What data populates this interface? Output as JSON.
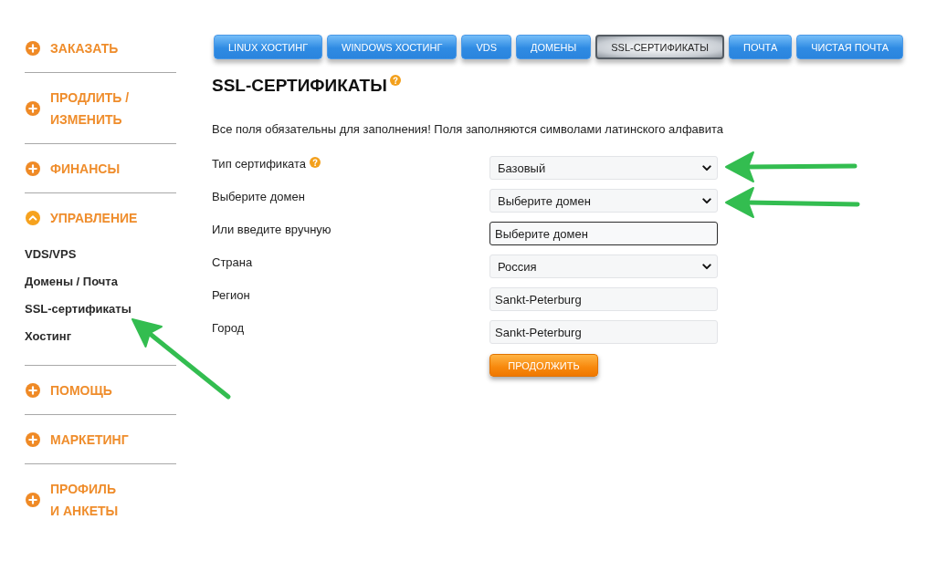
{
  "sidebar": {
    "sections": [
      {
        "label": "ЗАКАЗАТЬ",
        "expanded": false
      },
      {
        "label": "ПРОДЛИТЬ /\nИЗМЕНИТЬ",
        "expanded": false
      },
      {
        "label": "ФИНАНСЫ",
        "expanded": false
      },
      {
        "label": "УПРАВЛЕНИЕ",
        "expanded": true,
        "children": [
          {
            "label": "VDS/VPS"
          },
          {
            "label": "Домены / Почта"
          },
          {
            "label": "SSL-сертификаты"
          },
          {
            "label": "Хостинг"
          }
        ]
      },
      {
        "label": "ПОМОЩЬ",
        "expanded": false
      },
      {
        "label": "МАРКЕТИНГ",
        "expanded": false
      },
      {
        "label": "ПРОФИЛЬ\nИ АНКЕТЫ",
        "expanded": false
      }
    ]
  },
  "tabs": [
    {
      "label": "LINUX ХОСТИНГ",
      "selected": false
    },
    {
      "label": "WINDOWS ХОСТИНГ",
      "selected": false
    },
    {
      "label": "VDS",
      "selected": false
    },
    {
      "label": "ДОМЕНЫ",
      "selected": false
    },
    {
      "label": "SSL-СЕРТИФИКАТЫ",
      "selected": true
    },
    {
      "label": "ПОЧТА",
      "selected": false
    },
    {
      "label": "ЧИСТАЯ ПОЧТА",
      "selected": false
    }
  ],
  "heading": {
    "title": "SSL-СЕРТИФИКАТЫ",
    "help": true
  },
  "note": "Все поля обязательны для заполнения! Поля заполняются символами латинского алфавита",
  "form": {
    "fields": [
      {
        "label": "Тип сертификата",
        "help": true,
        "kind": "select",
        "value": "Базовый",
        "focused": false
      },
      {
        "label": "Выберите домен",
        "help": false,
        "kind": "select",
        "value": "Выберите домен",
        "focused": false
      },
      {
        "label": "Или введите вручную",
        "help": false,
        "kind": "text",
        "value": "Выберите домен",
        "focused": true
      },
      {
        "label": "Страна",
        "help": false,
        "kind": "select",
        "value": "Россия",
        "focused": false
      },
      {
        "label": "Регион",
        "help": false,
        "kind": "text",
        "value": "Sankt-Peterburg",
        "focused": false
      },
      {
        "label": "Город",
        "help": false,
        "kind": "text",
        "value": "Sankt-Peterburg",
        "focused": false
      }
    ],
    "submit": "ПРОДОЛЖИТЬ"
  }
}
